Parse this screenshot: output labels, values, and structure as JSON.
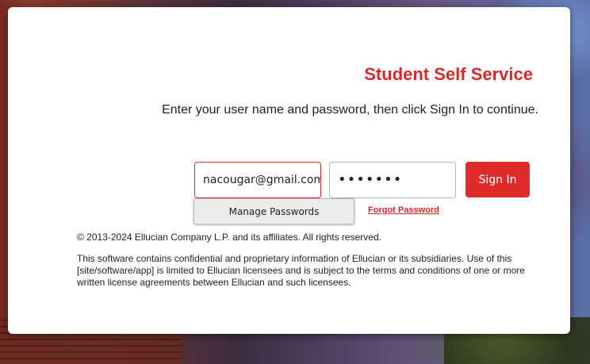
{
  "header": {
    "title": "Student Self Service",
    "instructions": "Enter your user name and password, then click Sign In to continue."
  },
  "form": {
    "username_value": "nacougar@gmail.com",
    "password_masked": "•••••••",
    "signin_label": "Sign In",
    "manage_passwords_label": "Manage Passwords",
    "forgot_password_label": "Forgot Password"
  },
  "footer": {
    "copyright": "© 2013-2024 Ellucian Company L.P. and its affiliates. All rights reserved.",
    "legal": "This software contains confidential and proprietary information of Ellucian or its subsidiaries. Use of this [site/software/app] is limited to Ellucian licensees and is subject to the terms and conditions of one or more written license agreements between Ellucian and such licensees."
  },
  "colors": {
    "accent": "#d42b2b",
    "button": "#e02b2b"
  }
}
